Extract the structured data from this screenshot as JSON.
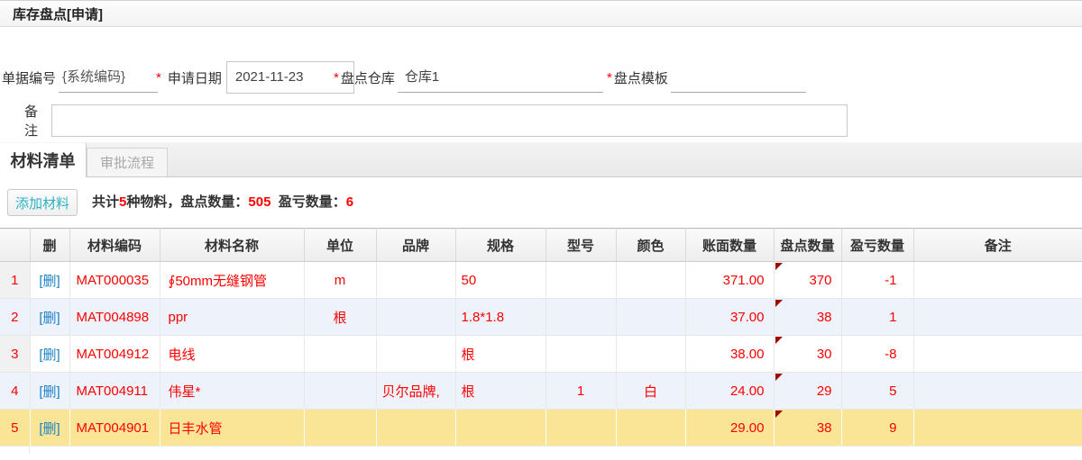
{
  "title": "库存盘点[申请]",
  "form": {
    "fields": [
      {
        "label": "单据编号",
        "required": false,
        "value": "{系统编码}"
      },
      {
        "label": "申请日期",
        "required": true,
        "value": "2021-11-23"
      },
      {
        "label": "盘点仓库",
        "required": true,
        "value": "仓库1"
      },
      {
        "label": "盘点模板",
        "required": true,
        "value": ""
      }
    ],
    "remark_label": "备注",
    "remark_value": ""
  },
  "tabs": [
    {
      "label": "材料清单",
      "active": true
    },
    {
      "label": "审批流程",
      "active": false
    }
  ],
  "toolbar": {
    "add_button": "添加材料",
    "summary_segments": [
      {
        "text": "共计",
        "highlight": false
      },
      {
        "text": "5",
        "highlight": true
      },
      {
        "text": "种物料，盘点数量：",
        "highlight": false
      },
      {
        "text": "505",
        "highlight": true
      },
      {
        "text": "  盈亏数量：",
        "highlight": false
      },
      {
        "text": "6",
        "highlight": true
      }
    ]
  },
  "table": {
    "headers": [
      "",
      "删",
      "材料编码",
      "材料名称",
      "单位",
      "品牌",
      "规格",
      "型号",
      "颜色",
      "账面数量",
      "盘点数量",
      "盈亏数量",
      "备注"
    ],
    "delete_label": "[删]",
    "rows": [
      {
        "num": "1",
        "code": "MAT000035",
        "name": "∮50mm无缝钢管",
        "unit": "m",
        "brand": "",
        "spec": "50",
        "model": "",
        "color": "",
        "book_qty": "371.00",
        "count_qty": "370",
        "diff_qty": "-1",
        "remark": "",
        "edited": true,
        "selected": false
      },
      {
        "num": "2",
        "code": "MAT004898",
        "name": "ppr",
        "unit": "根",
        "brand": "",
        "spec": "1.8*1.8",
        "model": "",
        "color": "",
        "book_qty": "37.00",
        "count_qty": "38",
        "diff_qty": "1",
        "remark": "",
        "edited": true,
        "selected": false
      },
      {
        "num": "3",
        "code": "MAT004912",
        "name": "电线",
        "unit": "",
        "brand": "",
        "spec": "根",
        "model": "",
        "color": "",
        "book_qty": "38.00",
        "count_qty": "30",
        "diff_qty": "-8",
        "remark": "",
        "edited": true,
        "selected": false
      },
      {
        "num": "4",
        "code": "MAT004911",
        "name": "伟星*",
        "unit": "",
        "brand": "贝尔品牌,",
        "spec": "根",
        "model": "1",
        "color": "白",
        "book_qty": "24.00",
        "count_qty": "29",
        "diff_qty": "5",
        "remark": "",
        "edited": true,
        "selected": false
      },
      {
        "num": "5",
        "code": "MAT004901",
        "name": "日丰水管",
        "unit": "",
        "brand": "",
        "spec": "",
        "model": "",
        "color": "",
        "book_qty": "29.00",
        "count_qty": "38",
        "diff_qty": "9",
        "remark": "",
        "edited": true,
        "selected": true
      }
    ]
  },
  "colors": {
    "value_red": "#ff0000",
    "link_blue": "#1a81c5",
    "button_teal": "#2db2c4",
    "selected_row": "#fae596",
    "alt_row": "#edf2fb",
    "edit_marker": "#a00000"
  }
}
